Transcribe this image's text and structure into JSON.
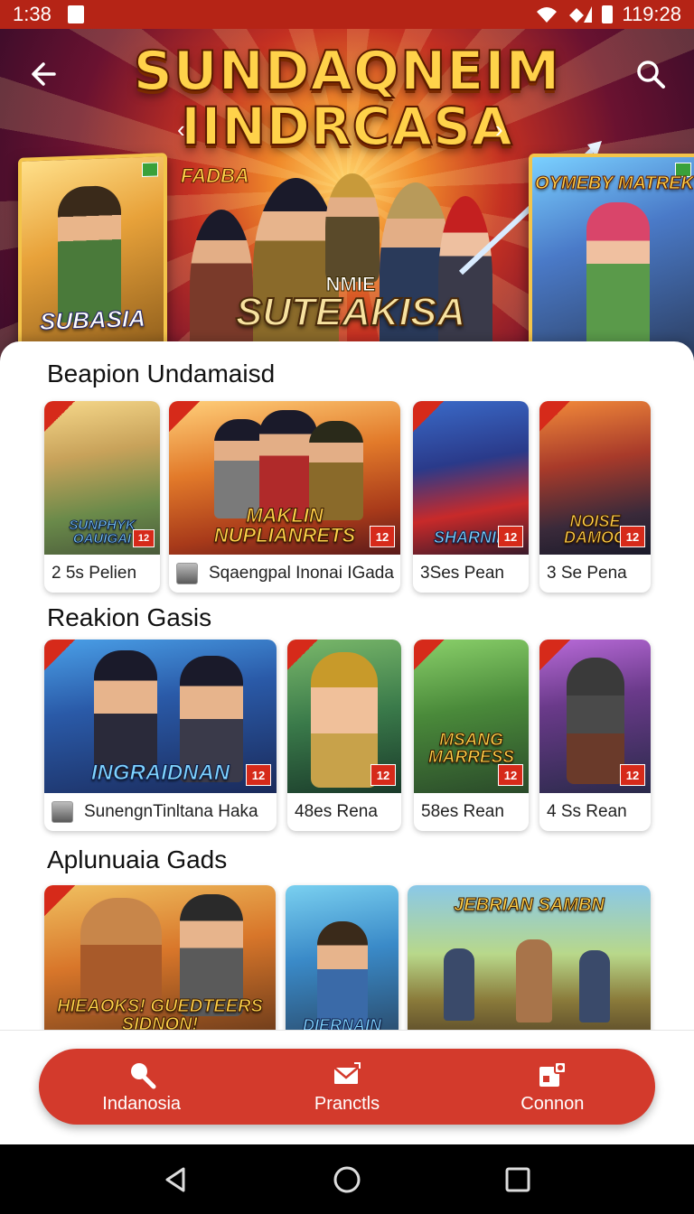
{
  "status_bar": {
    "time": "1:38",
    "clock_right": "119:28"
  },
  "hero": {
    "title_line1": "SUNDAQNEIM",
    "title_line2": "IINDRCASA",
    "tag_left": "FADBA",
    "center_small": "NMIE",
    "center_big": "SUTEAKISA",
    "poster_left_label": "SUBASIA",
    "poster_right_label": "OYMEBY MATREK"
  },
  "sections": [
    {
      "title": "Beapion Undamaisd",
      "cards": [
        {
          "art_label": "SUNPHYK OAUIGAI",
          "caption": "2 5s Pelien"
        },
        {
          "art_label": "MAKLIN NUPLIANRETS",
          "caption": "Sqaengpal Inonai IGada"
        },
        {
          "art_label": "SHARNIN",
          "caption": "3Ses Pean"
        },
        {
          "art_label": "NOISE DAMOG",
          "caption": "3 Se Pena"
        }
      ]
    },
    {
      "title": "Reakion Gasis",
      "cards": [
        {
          "art_label": "INGRAIDNAN",
          "caption": "SunengnTinltana Haka"
        },
        {
          "art_label": "",
          "caption": "48es Rena"
        },
        {
          "art_label": "MSANG MARRESS",
          "caption": "58es Rean"
        },
        {
          "art_label": "",
          "caption": "4 Ss Rean"
        }
      ]
    },
    {
      "title": "Aplunuaia Gads",
      "cards": [
        {
          "art_label": "HIEAOKS! GUEDTEERS SIDNON!"
        },
        {
          "art_label": "DIERNAIN"
        },
        {
          "art_label": "JEBRIAN SAMBN"
        }
      ]
    }
  ],
  "bottom_nav": {
    "items": [
      {
        "label": "Indanosia",
        "icon": "search-icon"
      },
      {
        "label": "Pranctls",
        "icon": "envelope-icon"
      },
      {
        "label": "Connon",
        "icon": "apps-icon"
      }
    ]
  },
  "colors": {
    "accent": "#d33a2c",
    "status_bar": "#b52416"
  }
}
